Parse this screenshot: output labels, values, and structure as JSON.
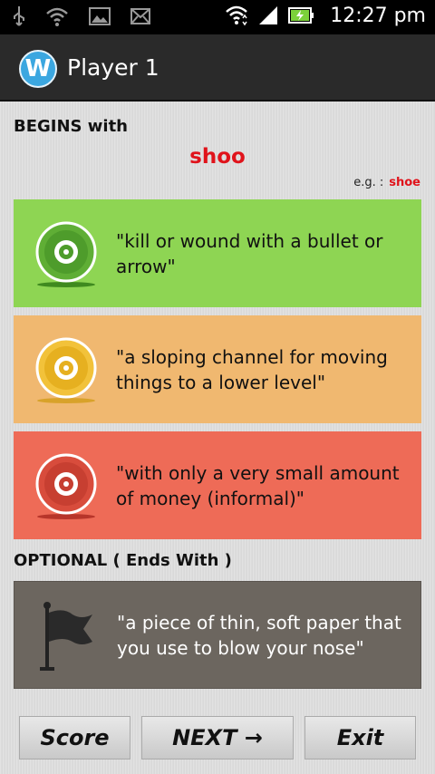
{
  "status_bar": {
    "time": "12:27 pm",
    "icons": [
      "usb-icon",
      "wifi-icon",
      "image-icon",
      "mail-icon",
      "wifi-signal-icon",
      "cell-signal-icon",
      "battery-icon"
    ]
  },
  "header": {
    "logo_letter": "W",
    "title": "Player 1"
  },
  "begins": {
    "label": "BEGINS with",
    "word": "shoo",
    "example_prefix": "e.g. :",
    "example_word": "shoe"
  },
  "clues": [
    {
      "text": "\"kill or wound with a bullet or arrow\"",
      "color": "#8ed553",
      "icon": "target-icon"
    },
    {
      "text": "\"a sloping channel for moving things to a lower level\"",
      "color": "#f0b870",
      "icon": "target-icon"
    },
    {
      "text": "\"with only a very small amount of money (informal)\"",
      "color": "#ee6b57",
      "icon": "target-icon"
    }
  ],
  "optional": {
    "label": "OPTIONAL ( Ends With )",
    "clue": "\"a piece of thin, soft paper that you use to blow your nose\"",
    "icon": "flag-icon",
    "color": "#6c665f"
  },
  "buttons": {
    "score": "Score",
    "next": "NEXT →",
    "exit": "Exit"
  }
}
